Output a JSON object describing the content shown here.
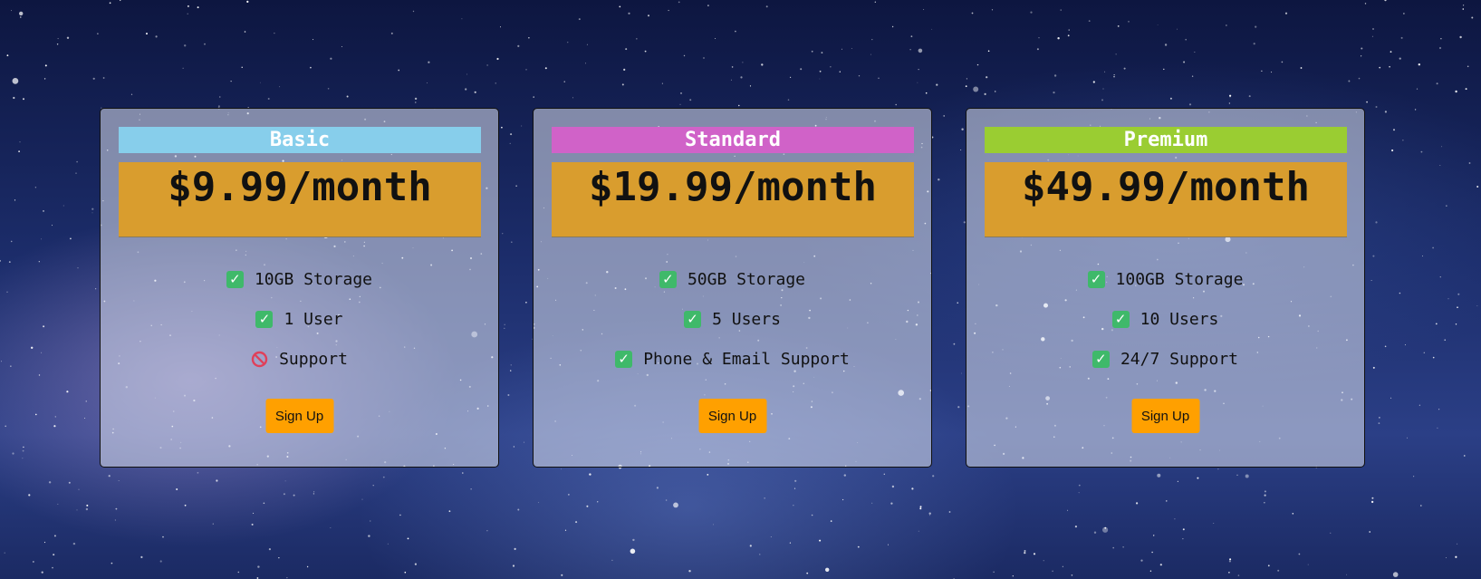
{
  "plans": [
    {
      "name": "Basic",
      "header_color": "#87ceeb",
      "price": "$9.99/month",
      "features": [
        {
          "text": "10GB Storage",
          "icon": "check-icon"
        },
        {
          "text": "1 User",
          "icon": "check-icon"
        },
        {
          "text": "Support",
          "icon": "prohibited-icon"
        }
      ],
      "button_label": "Sign Up"
    },
    {
      "name": "Standard",
      "header_color": "#d062c8",
      "price": "$19.99/month",
      "features": [
        {
          "text": "50GB Storage",
          "icon": "check-icon"
        },
        {
          "text": "5 Users",
          "icon": "check-icon"
        },
        {
          "text": "Phone & Email Support",
          "icon": "check-icon"
        }
      ],
      "button_label": "Sign Up"
    },
    {
      "name": "Premium",
      "header_color": "#9acd32",
      "price": "$49.99/month",
      "features": [
        {
          "text": "100GB Storage",
          "icon": "check-icon"
        },
        {
          "text": "10 Users",
          "icon": "check-icon"
        },
        {
          "text": "24/7 Support",
          "icon": "check-icon"
        }
      ],
      "button_label": "Sign Up"
    }
  ],
  "colors": {
    "price_background": "#d99d2e",
    "button_background": "#ffa000",
    "check_green": "#3fb96a",
    "prohibited_red": "#e0405a"
  }
}
